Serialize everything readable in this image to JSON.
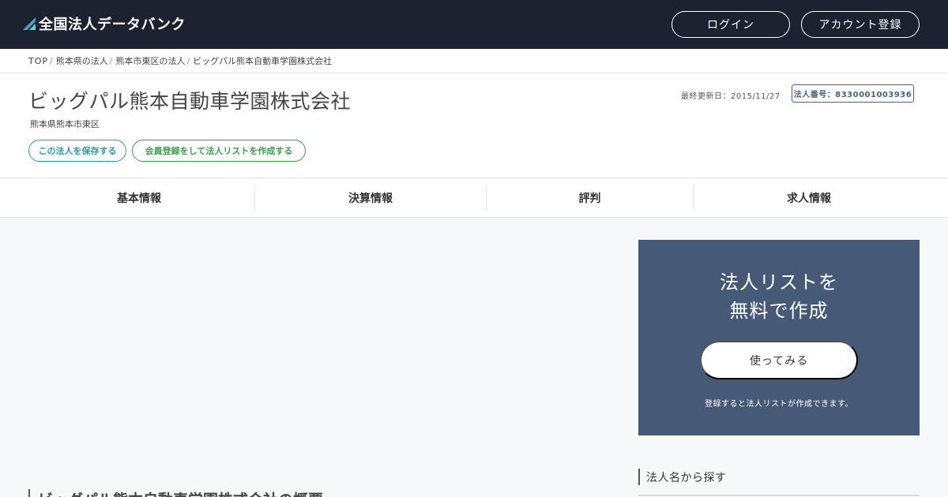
{
  "header": {
    "site_name": "全国法人データバンク",
    "login_label": "ログイン",
    "register_label": "アカウント登録",
    "brand_color": "#1c2230"
  },
  "breadcrumb": [
    "TOP",
    "熊本県の法人",
    "熊本市東区の法人",
    "ビッグパル熊本自動車学園株式会社"
  ],
  "company": {
    "name": "ビッグパル熊本自動車学園株式会社",
    "location": "熊本県熊本市東区",
    "updated": "最終更新日：2015/11/27",
    "corporate_number": "法人番号：8330001003936",
    "save_label": "この法人を保存する",
    "create_list_label": "会員登録をして法人リストを作成する"
  },
  "tabs": [
    "基本情報",
    "決算情報",
    "評判",
    "求人情報"
  ],
  "promo": {
    "title_line1": "法人リストを",
    "title_line2": "無料で作成",
    "button_label": "使ってみる",
    "note": "登録すると法人リストが作成できます。",
    "color": "#465a77"
  },
  "sidebar": {
    "search_heading": "法人名から探す"
  },
  "main": {
    "overview_heading": "ビッグパル熊本自動車学園株式会社の概要"
  },
  "colors": {
    "save_pill": "#2b9ca3",
    "list_pill": "#3aa04a",
    "background": "#f7f8fa"
  }
}
